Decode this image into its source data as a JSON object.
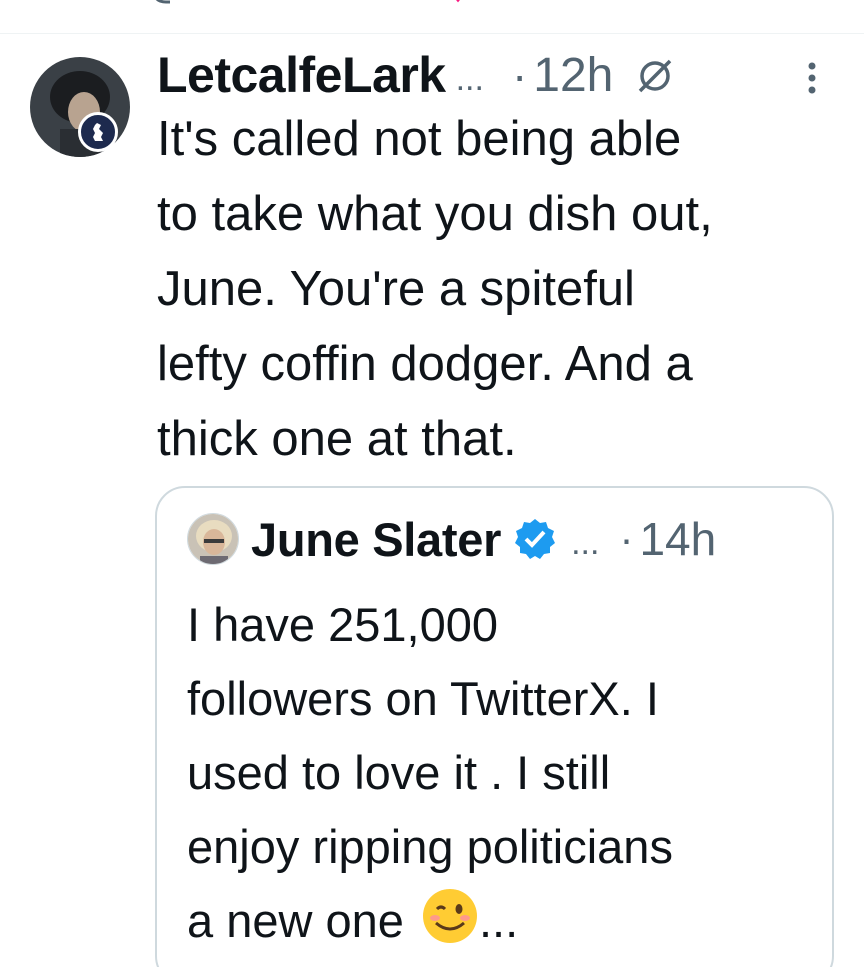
{
  "colors": {
    "text_primary": "#0f1419",
    "text_secondary": "#536471",
    "border": "#cfd9de",
    "verified_blue": "#1d9bf0",
    "like_pink": "#f91880"
  },
  "top_bar": {
    "icons": [
      "reply-icon",
      "retweet-icon",
      "like-icon",
      "views-icon",
      "bookmark-icon",
      "share-icon"
    ]
  },
  "tweet": {
    "author_name": "LetcalfeLark",
    "name_ellipsis": "...",
    "separator": "·",
    "time": "12h",
    "text_lines": [
      "It's called not being able",
      "to take what you dish out,",
      "June. You're a spiteful",
      "lefty coffin dodger. And a",
      "thick one at that."
    ],
    "icons": [
      "avatar",
      "flag-badge-icon",
      "edit-icon",
      "more-icon"
    ]
  },
  "quoted_tweet": {
    "author_name": "June Slater",
    "verified": true,
    "name_ellipsis": "...",
    "separator": "·",
    "time": "14h",
    "text_lines": [
      "I have 251,000",
      "followers on TwitterX. I",
      "used to love it . I still",
      "enjoy ripping politicians",
      "a new one"
    ],
    "trailing_emoji": "winking-face-emoji",
    "trailing_text": "..."
  }
}
